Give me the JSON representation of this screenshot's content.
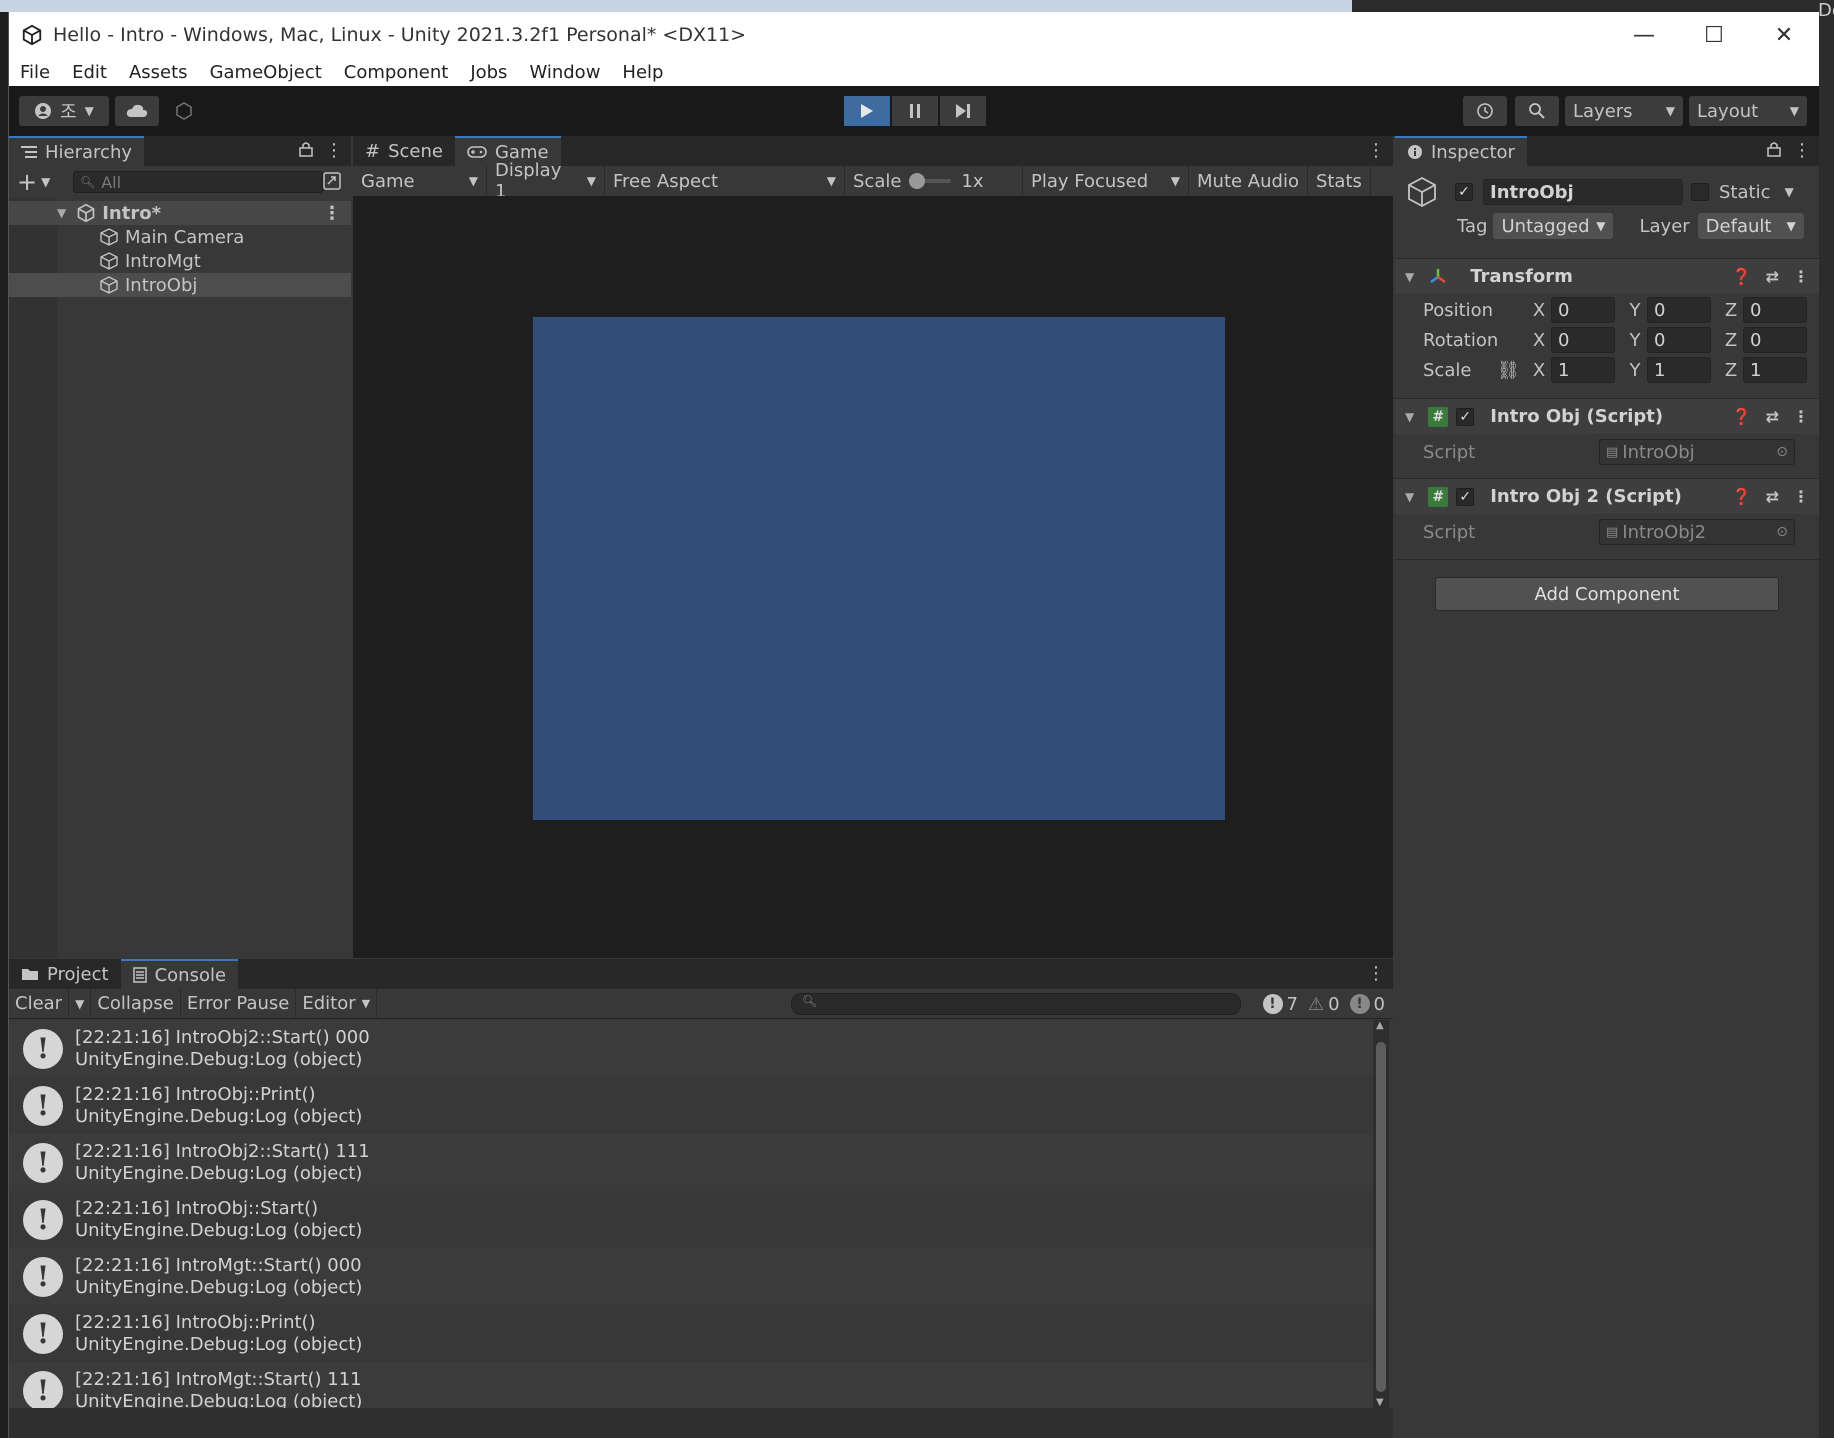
{
  "window": {
    "title": "Hello - Intro - Windows, Mac, Linux - Unity 2021.3.2f1 Personal* <DX11>",
    "buttons": {
      "minimize": "—",
      "maximize": "☐",
      "close": "✕"
    }
  },
  "menu": [
    "File",
    "Edit",
    "Assets",
    "GameObject",
    "Component",
    "Jobs",
    "Window",
    "Help"
  ],
  "toolbar": {
    "account_label": "조",
    "layers_label": "Layers",
    "layout_label": "Layout"
  },
  "hierarchy": {
    "tab_label": "Hierarchy",
    "search_placeholder": "All",
    "scene_name": "Intro*",
    "items": [
      "Main Camera",
      "IntroMgt",
      "IntroObj"
    ],
    "selected_item": "IntroObj"
  },
  "scene_tabs": {
    "scene_label": "Scene",
    "game_label": "Game"
  },
  "game_toolbar": {
    "mode": "Game",
    "display": "Display 1",
    "aspect": "Free Aspect",
    "scale_label": "Scale",
    "scale_value": "1x",
    "play_focused": "Play Focused",
    "mute_audio": "Mute Audio",
    "stats": "Stats"
  },
  "game_view": {
    "background_color": "#314d79"
  },
  "inspector": {
    "tab_label": "Inspector",
    "object_name": "IntroObj",
    "static_label": "Static",
    "tag_label": "Tag",
    "tag_value": "Untagged",
    "layer_label": "Layer",
    "layer_value": "Default",
    "transform": {
      "title": "Transform",
      "position": {
        "label": "Position",
        "x": "0",
        "y": "0",
        "z": "0"
      },
      "rotation": {
        "label": "Rotation",
        "x": "0",
        "y": "0",
        "z": "0"
      },
      "scale": {
        "label": "Scale",
        "x": "1",
        "y": "1",
        "z": "1"
      }
    },
    "components": [
      {
        "title": "Intro Obj (Script)",
        "script_label": "Script",
        "script_value": "IntroObj"
      },
      {
        "title": "Intro Obj 2 (Script)",
        "script_label": "Script",
        "script_value": "IntroObj2"
      }
    ],
    "add_component": "Add Component"
  },
  "console": {
    "project_tab": "Project",
    "console_tab": "Console",
    "clear": "Clear",
    "collapse": "Collapse",
    "error_pause": "Error Pause",
    "editor": "Editor",
    "count_log": "7",
    "count_warn": "0",
    "count_error": "0",
    "logs": [
      {
        "line1": "[22:21:16] IntroObj2::Start() 000",
        "line2": "UnityEngine.Debug:Log (object)"
      },
      {
        "line1": "[22:21:16] IntroObj::Print()",
        "line2": "UnityEngine.Debug:Log (object)"
      },
      {
        "line1": "[22:21:16] IntroObj2::Start() 111",
        "line2": "UnityEngine.Debug:Log (object)"
      },
      {
        "line1": "[22:21:16] IntroObj::Start()",
        "line2": "UnityEngine.Debug:Log (object)"
      },
      {
        "line1": "[22:21:16] IntroMgt::Start() 000",
        "line2": "UnityEngine.Debug:Log (object)"
      },
      {
        "line1": "[22:21:16] IntroObj::Print()",
        "line2": "UnityEngine.Debug:Log (object)"
      },
      {
        "line1": "[22:21:16] IntroMgt::Start() 111",
        "line2": "UnityEngine.Debug:Log (object)"
      }
    ]
  },
  "background": {
    "right_edge_text": "Debu"
  }
}
